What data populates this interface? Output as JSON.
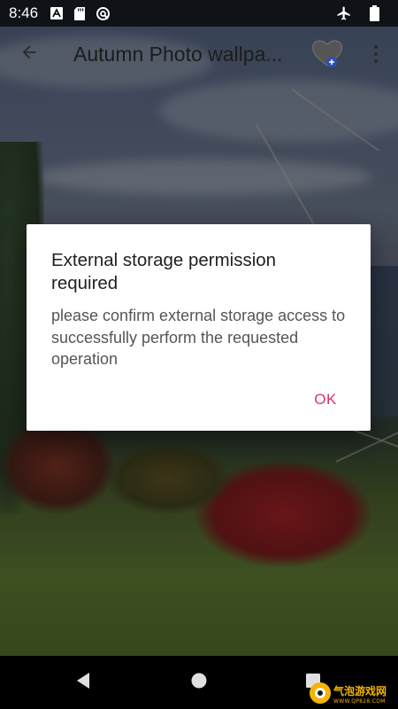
{
  "status_bar": {
    "time": "8:46",
    "left_icons": [
      "font-icon",
      "sd-card-icon",
      "sync-icon"
    ],
    "right_icons": [
      "airplane-mode-icon",
      "battery-icon"
    ]
  },
  "app_bar": {
    "title": "Autumn Photo wallpa...",
    "back_icon": "arrow-left-icon",
    "favorite_icon": "heart-icon",
    "menu_icon": "more-vert-icon"
  },
  "dialog": {
    "title": "External storage permission required",
    "message": "please confirm external storage access to successfully perform the requested operation",
    "ok_label": "OK",
    "accent_color": "#D6336C"
  },
  "nav_bar": {
    "icons": [
      "back-triangle-icon",
      "home-circle-icon",
      "recents-square-icon"
    ]
  },
  "watermark": {
    "text": "气泡游戏网",
    "subtext": "WWW.QP828.COM"
  }
}
